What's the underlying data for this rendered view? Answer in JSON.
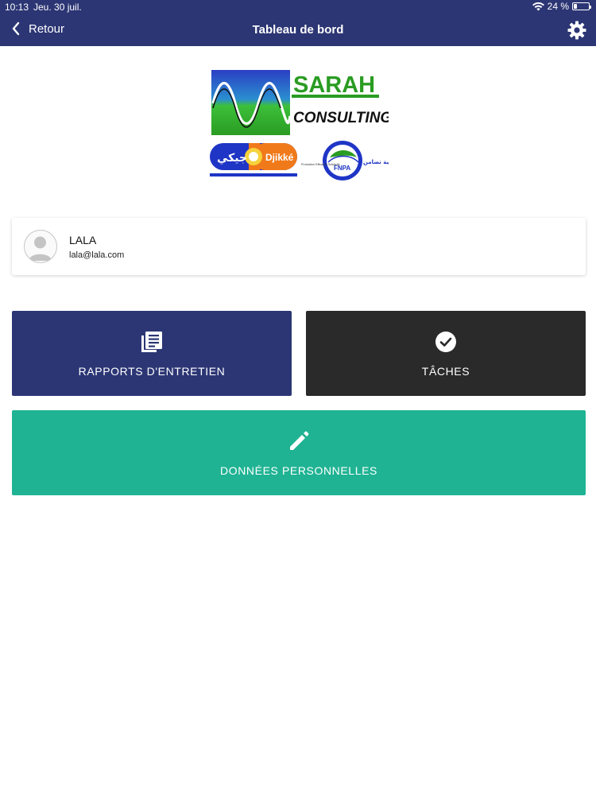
{
  "status_bar": {
    "time": "10:13",
    "date": "Jeu. 30 juil.",
    "battery": "24 %",
    "battery_level": 0.24
  },
  "nav": {
    "back_label": "Retour",
    "title": "Tableau de bord"
  },
  "logo": {
    "brand_top": "SARAH",
    "brand_bottom": "CONSULTING",
    "partner_left": "Djikké",
    "partner_left_ar": "جيكي",
    "partner_right": "FNPA",
    "partner_tag": "Production Efficacité Solidarité",
    "partner_tag_ar": "إنتاج فعالية تضامن"
  },
  "profile": {
    "name": "LALA",
    "email": "lala@lala.com"
  },
  "tiles": {
    "rapports": {
      "label": "RAPPORTS D'ENTRETIEN",
      "icon": "document-list-icon",
      "color": "#2c3674"
    },
    "taches": {
      "label": "TÂCHES",
      "icon": "check-circle-icon",
      "color": "#2a2a2b"
    },
    "donnees": {
      "label": "DONNÉES PERSONNELLES",
      "icon": "pencil-icon",
      "color": "#1fb393"
    }
  }
}
